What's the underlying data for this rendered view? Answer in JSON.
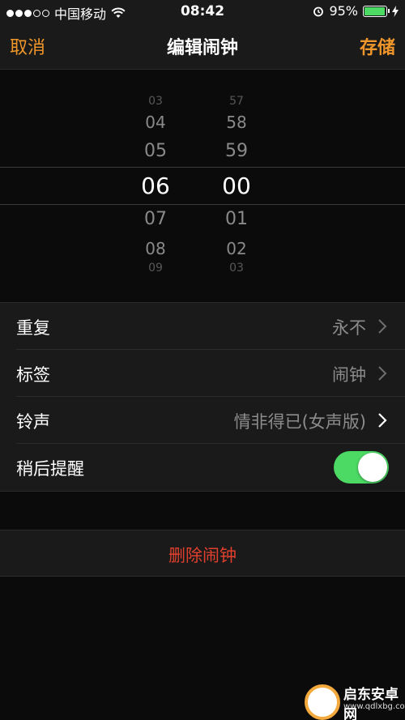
{
  "status_bar": {
    "carrier": "中国移动",
    "time": "08:42",
    "battery_percent": "95%",
    "battery_level": 0.95
  },
  "nav": {
    "cancel": "取消",
    "title": "编辑闹钟",
    "save": "存储"
  },
  "picker": {
    "hours": [
      "03",
      "04",
      "05",
      "06",
      "07",
      "08",
      "09"
    ],
    "minutes": [
      "57",
      "58",
      "59",
      "00",
      "01",
      "02",
      "03"
    ],
    "selected_hour": "06",
    "selected_minute": "00"
  },
  "settings": {
    "repeat": {
      "label": "重复",
      "value": "永不"
    },
    "label": {
      "label": "标签",
      "value": "闹钟"
    },
    "sound": {
      "label": "铃声",
      "value": "情非得已(女声版)"
    },
    "snooze": {
      "label": "稍后提醒",
      "on": true
    }
  },
  "delete_label": "删除闹钟",
  "watermark": {
    "title": "启东安卓网",
    "url": "www.qdlxbg.com"
  },
  "colors": {
    "accent": "#f0962a",
    "toggle_on": "#4cd964",
    "delete": "#e0402d"
  }
}
